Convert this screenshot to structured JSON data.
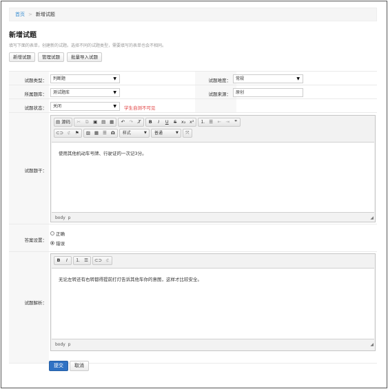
{
  "breadcrumb": {
    "home": "首页",
    "separator": ">",
    "current": "新增试题"
  },
  "page": {
    "title": "新增试题",
    "intro": "填写下面的表单，创建新的试题。选择不同的试题类型，需要填写的表单也会不相同。"
  },
  "tabs": [
    "新增试题",
    "管理试题",
    "批量导入试题"
  ],
  "form": {
    "type_label": "试题类型：",
    "type_value": "判断题",
    "difficulty_label": "试题难度：",
    "difficulty_value": "常规",
    "bank_label": "所属题库：",
    "bank_value": "测试题库",
    "source_label": "试题来源：",
    "source_value": "原创",
    "status_label": "试题状态：",
    "status_value": "关闭",
    "status_warning": "学生自测不可见",
    "stem_label": "试题题干：",
    "answer_label": "答案设置：",
    "answer_options": [
      "正确",
      "错误"
    ],
    "answer_selected": "错误",
    "analysis_label": "试题解析："
  },
  "editor1": {
    "source_btn": "源码",
    "style_combo": "样式",
    "format_combo": "普通",
    "content": "使用其他机动车号牌、行驶证的一次记3分。",
    "path": [
      "body",
      "p"
    ]
  },
  "editor2": {
    "content": "无论左转还有右转都得提前打灯告诉其他车你的意图，这样才比较安全。",
    "path": [
      "body",
      "p"
    ]
  },
  "actions": {
    "submit": "提交",
    "cancel": "取消"
  },
  "colors": {
    "primary": "#2f72c4",
    "warning": "#e03c3c",
    "link": "#3a8fd2"
  }
}
